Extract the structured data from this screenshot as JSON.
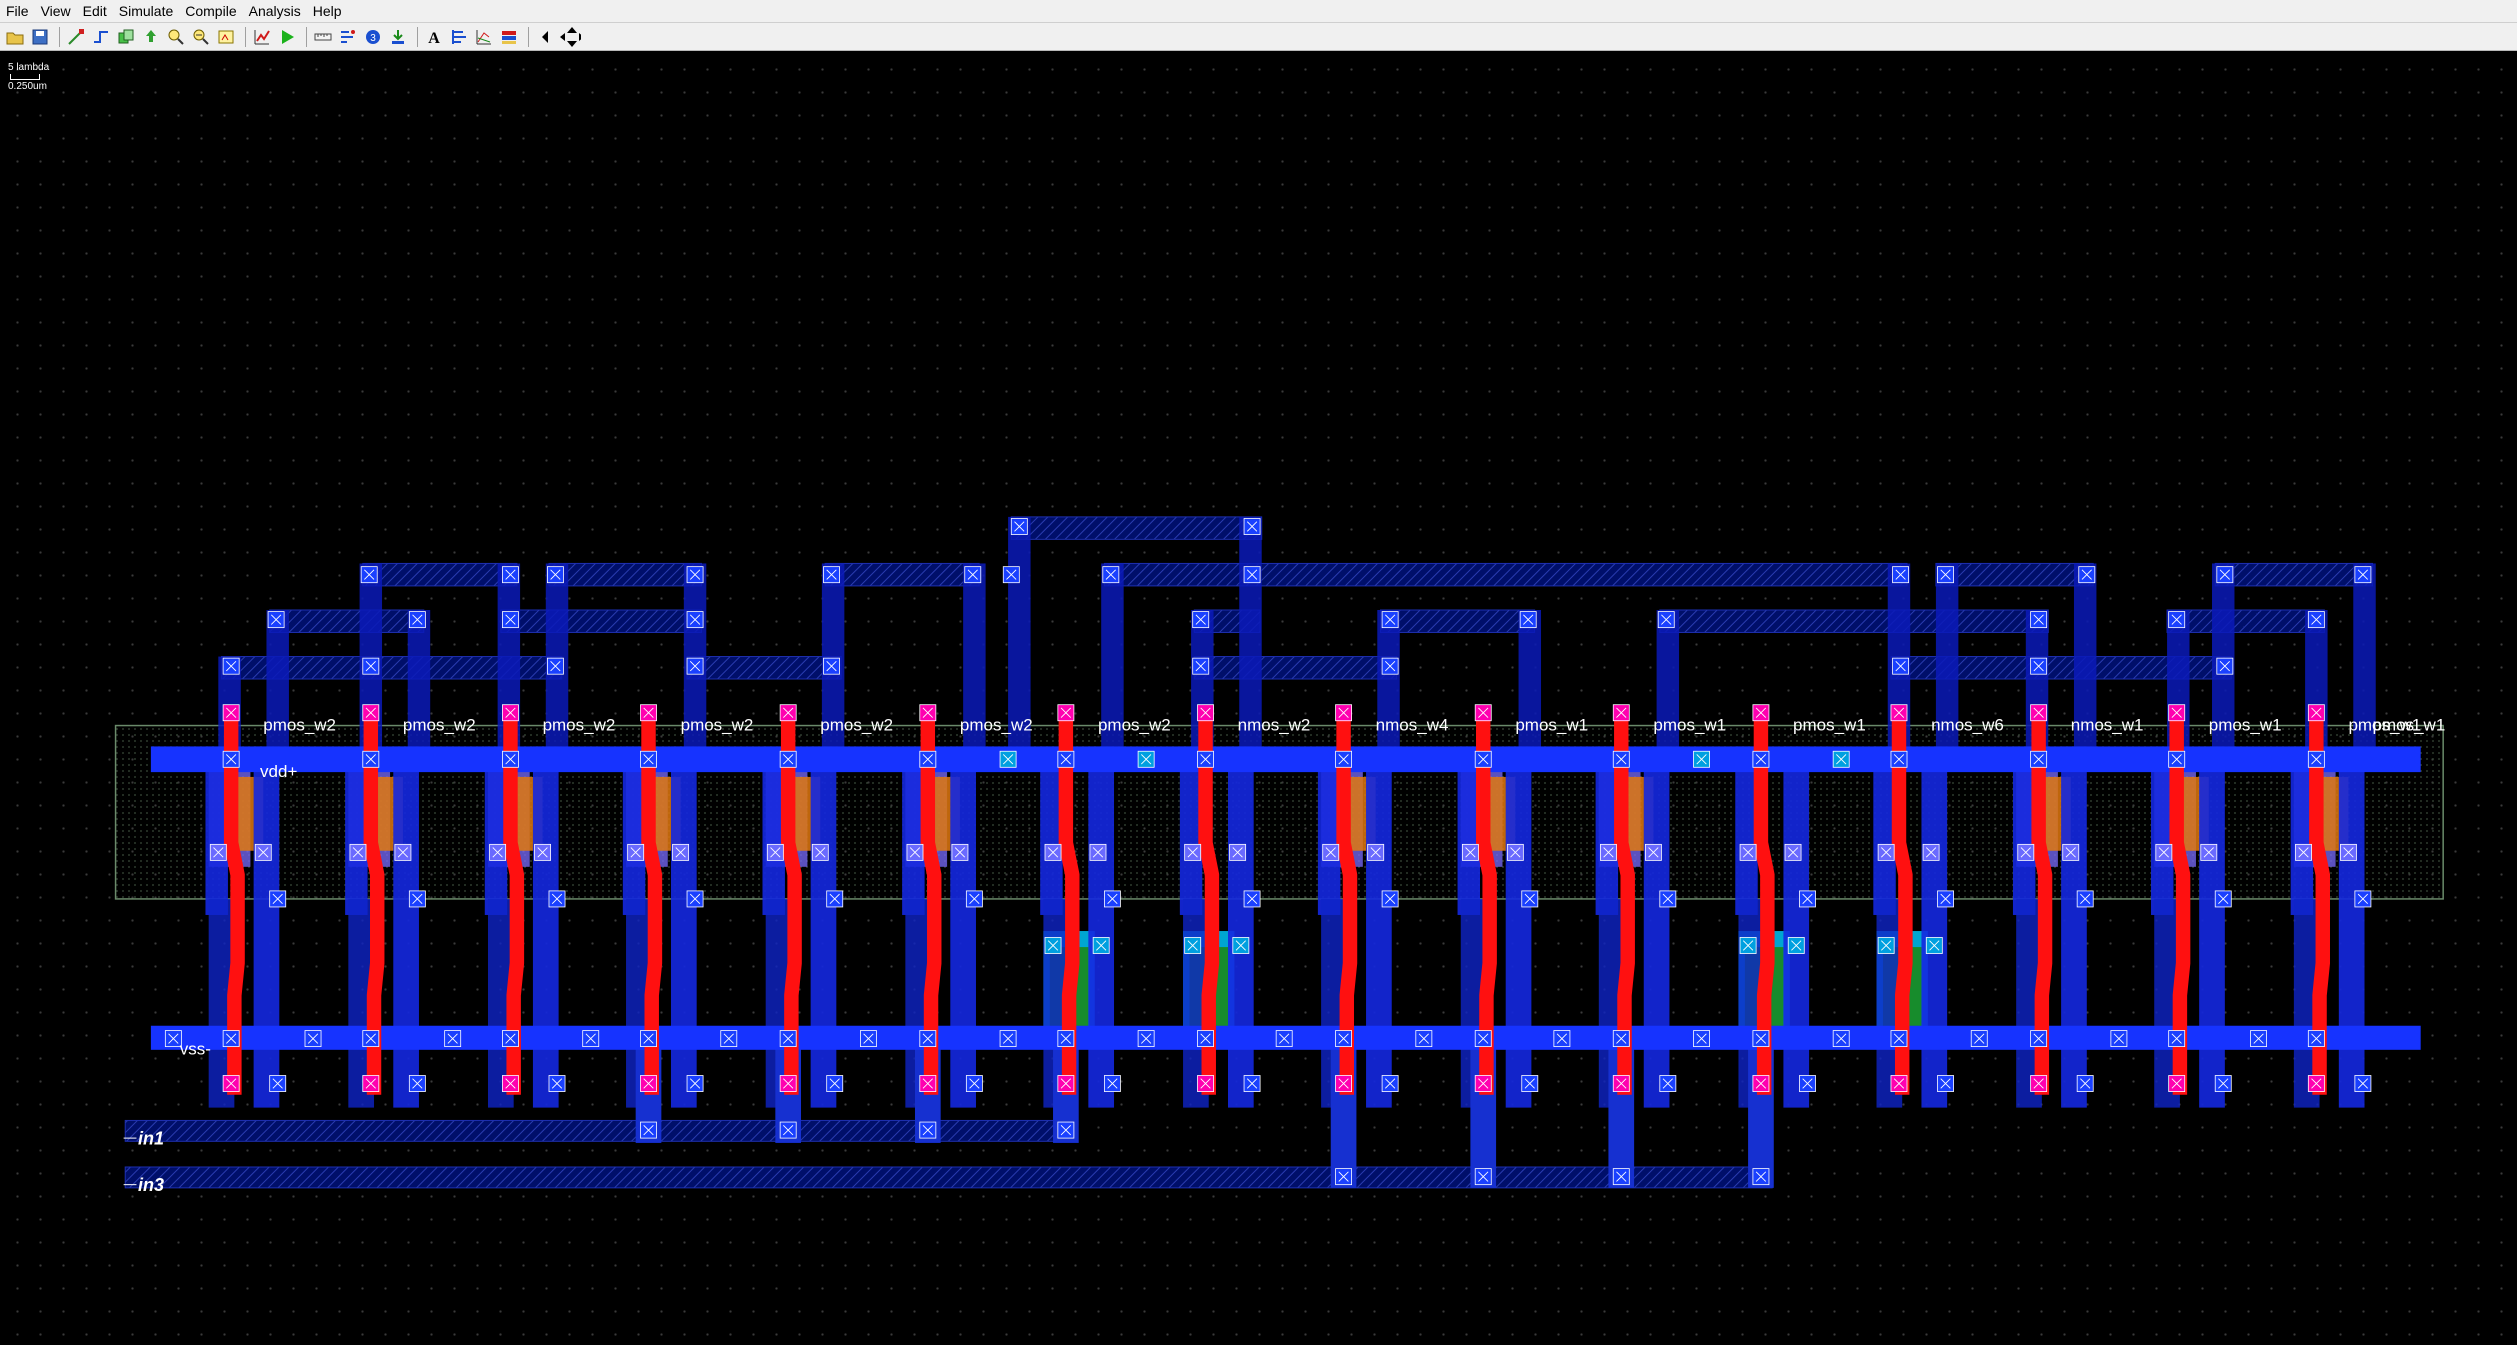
{
  "menu": [
    "File",
    "View",
    "Edit",
    "Simulate",
    "Compile",
    "Analysis",
    "Help"
  ],
  "toolbar_icons": [
    "open-icon",
    "save-icon",
    "wire-icon",
    "route-icon",
    "copy-icon",
    "move-icon",
    "zoom-in-icon",
    "zoom-out-icon",
    "zoom-fit-icon",
    "measure-icon",
    "run-icon",
    "ruler-icon",
    "extract-icon",
    "drc-icon",
    "place-icon",
    "text-icon",
    "align-icon",
    "graph-icon",
    "layers-icon",
    "nav-left-icon",
    "nav-arrows-icon"
  ],
  "scale": {
    "lambda": "5 lambda",
    "microns": "0.250um"
  },
  "devices": [
    "pmos_w2",
    "pmos_w2",
    "pmos_w2",
    "pmos_w2",
    "pmos_w2",
    "pmos_w2",
    "pmos_w2",
    "nmos_w2",
    "nmos_w4",
    "pmos_w1",
    "pmos_w1",
    "pmos_w1",
    "nmos_w6",
    "nmos_w1",
    "pmos_w1",
    "pmos_w1",
    "pmos_w1"
  ],
  "nets": {
    "vdd": "vdd+",
    "vss": "vss-",
    "in1": "in1",
    "in3": "in3"
  },
  "colors": {
    "background": "#000000",
    "metal1": "#0000ff",
    "poly": "#ff0000",
    "contact": "#ff00cc",
    "ndiff": "#00aa00",
    "pwell": "#00aadd"
  }
}
